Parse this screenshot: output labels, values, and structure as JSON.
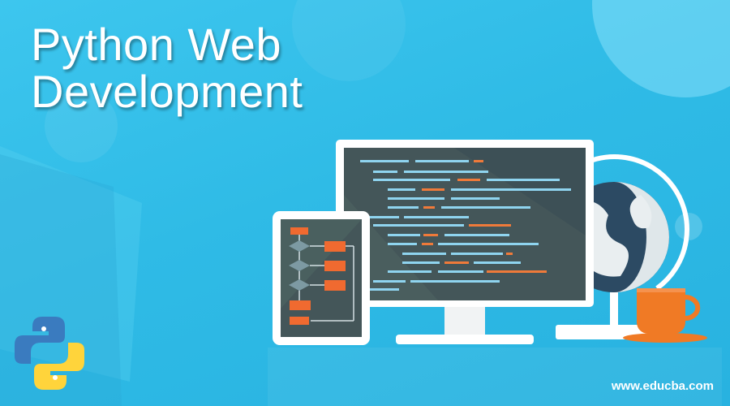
{
  "banner": {
    "title_line1": "Python Web",
    "title_line2": "Development",
    "site_url": "www.educba.com"
  },
  "colors": {
    "background": "#34bde6",
    "monitor_screen": "#4a5d5f",
    "code_line": "#8fd4ef",
    "code_accent": "#ef7a3a",
    "flow_box": "#f06a30",
    "flow_diamond": "#7d9aa3",
    "cup": "#f07a25",
    "python_blue": "#3a7bbf",
    "python_yellow": "#ffd43b"
  },
  "icons": [
    "python-logo-icon",
    "globe-icon",
    "coffee-cup-icon",
    "monitor-icon",
    "tablet-icon"
  ]
}
